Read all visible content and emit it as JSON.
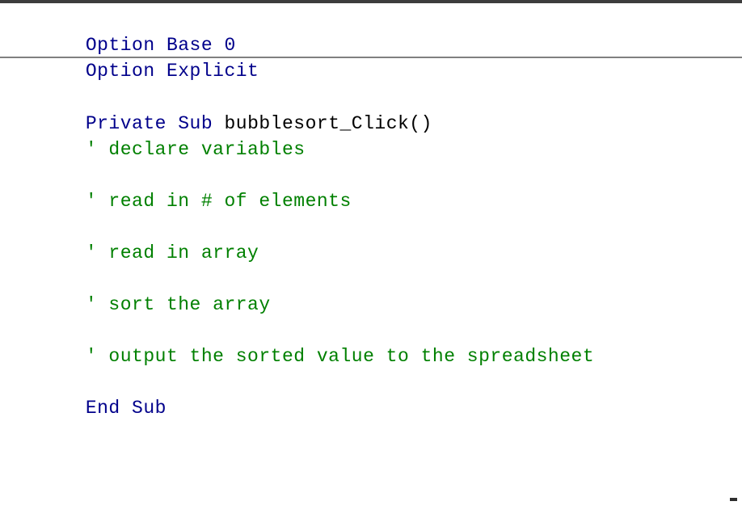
{
  "window": {
    "title_bar_color": "#3d3d3d",
    "background_color": "#ffffff",
    "divider_color": "#808080"
  },
  "syntax_colors": {
    "keyword": "#00008b",
    "identifier": "#000000",
    "comment": "#008000"
  },
  "declarations_section": {
    "lines": [
      {
        "id": "decl-line-1",
        "segments": [
          {
            "type": "keyword",
            "text": "Option Base 0"
          }
        ]
      },
      {
        "id": "decl-line-2",
        "segments": [
          {
            "type": "keyword",
            "text": "Option Explicit"
          }
        ]
      }
    ]
  },
  "procedure_section": {
    "lines": [
      {
        "id": "proc-line-1",
        "kind": "code",
        "keyword": "Private Sub ",
        "identifier": "bubblesort_Click()",
        "text": "Private Sub bubblesort_Click()"
      },
      {
        "id": "proc-line-2",
        "kind": "comment",
        "text": "' declare variables"
      },
      {
        "id": "proc-line-3",
        "kind": "blank",
        "text": " "
      },
      {
        "id": "proc-line-4",
        "kind": "comment",
        "text": "' read in # of elements"
      },
      {
        "id": "proc-line-5",
        "kind": "blank",
        "text": " "
      },
      {
        "id": "proc-line-6",
        "kind": "comment",
        "text": "' read in array"
      },
      {
        "id": "proc-line-7",
        "kind": "blank",
        "text": " "
      },
      {
        "id": "proc-line-8",
        "kind": "comment",
        "text": "' sort the array"
      },
      {
        "id": "proc-line-9",
        "kind": "blank",
        "text": " "
      },
      {
        "id": "proc-line-10",
        "kind": "comment",
        "text": "' output the sorted value to the spreadsheet"
      },
      {
        "id": "proc-line-11",
        "kind": "blank",
        "text": " "
      },
      {
        "id": "proc-line-12",
        "kind": "code",
        "keyword": "End Sub",
        "identifier": "",
        "text": "End Sub"
      }
    ]
  }
}
